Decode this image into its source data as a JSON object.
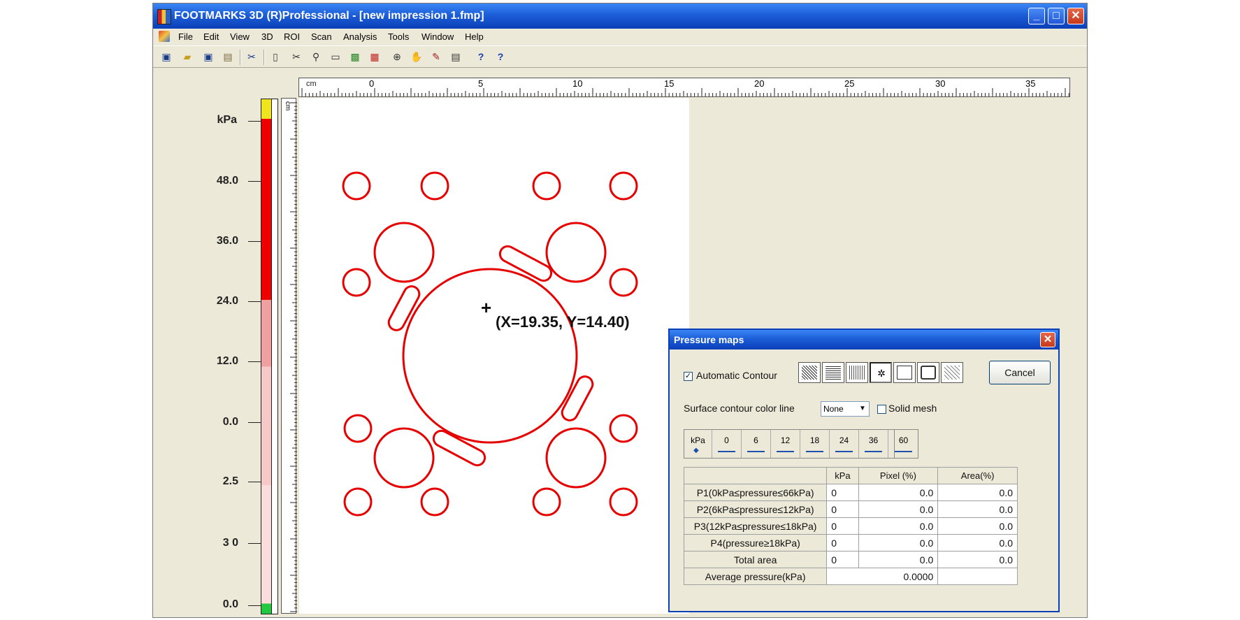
{
  "window": {
    "title": "FOOTMARKS 3D (R)Professional - [new impression 1.fmp]"
  },
  "menu": [
    "File",
    "Edit",
    "View",
    "3D",
    "ROI",
    "Scan",
    "Analysis",
    "Tools",
    "Window",
    "Help"
  ],
  "toolbar_icons": [
    "save-icon",
    "open-folder-icon",
    "save-all-icon",
    "paste-icon",
    "cut-icon",
    "page-icon",
    "scissors-icon",
    "zoom-icon",
    "preview-icon",
    "green-grid-icon",
    "color-grid-icon",
    "zoom-circle-icon",
    "hand-icon",
    "measure-icon",
    "print-icon",
    "help-icon",
    "help-context-icon"
  ],
  "ruler": {
    "unit": "cm",
    "h_labels": [
      "0",
      "5",
      "10",
      "15",
      "20",
      "25",
      "30",
      "35"
    ],
    "v_unit": "cm"
  },
  "legend": {
    "unit": "kPa",
    "labels": [
      "48.0",
      "36.0",
      "24.0",
      "12.0",
      "0.0",
      "2.5",
      "3 0",
      "0.0"
    ]
  },
  "coordinate_readout": "(X=19.35, Y=14.40)",
  "colors": {
    "contour": "#e60000",
    "title_bar": "#0a3fb8"
  },
  "dialog": {
    "title": "Pressure maps",
    "auto_contour_label": "Automatic Contour",
    "auto_contour_checked": true,
    "cancel_label": "Cancel",
    "surface_label": "Surface contour color line",
    "surface_value": "None",
    "solid_mesh_label": "Solid mesh",
    "solid_mesh_checked": false,
    "scale": {
      "unit": "kPa",
      "values": [
        "0",
        "6",
        "12",
        "18",
        "24",
        "36",
        "60"
      ]
    },
    "table": {
      "headers": [
        "",
        "kPa",
        "Pixel (%)",
        "Area(%)"
      ],
      "rows": [
        {
          "label": "P1(0kPa≤pressure≤66kPa)",
          "kpa": "0",
          "pixel": "0.0",
          "area": "0.0"
        },
        {
          "label": "P2(6kPa≤pressure≤12kPa)",
          "kpa": "0",
          "pixel": "0.0",
          "area": "0.0"
        },
        {
          "label": "P3(12kPa≤pressure≤18kPa)",
          "kpa": "0",
          "pixel": "0.0",
          "area": "0.0"
        },
        {
          "label": "P4(pressure≥18kPa)",
          "kpa": "0",
          "pixel": "0.0",
          "area": "0.0"
        },
        {
          "label": "Total area",
          "kpa": "0",
          "pixel": "0.0",
          "area": "0.0"
        }
      ],
      "average_label": "Average pressure(kPa)",
      "average_value": "0.0000"
    }
  }
}
